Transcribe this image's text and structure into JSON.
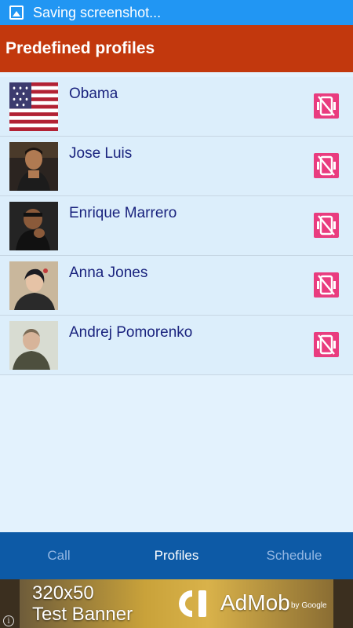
{
  "status_bar": {
    "icon": "gallery-icon",
    "text": "Saving screenshot..."
  },
  "app_bar": {
    "title": "Predefined profiles"
  },
  "profiles": [
    {
      "name": "Obama",
      "avatar": "flag-avatar",
      "action_icon": "delete-icon"
    },
    {
      "name": "Jose Luis",
      "avatar": "person-avatar",
      "action_icon": "delete-icon"
    },
    {
      "name": "Enrique Marrero",
      "avatar": "person-avatar",
      "action_icon": "delete-icon"
    },
    {
      "name": "Anna Jones",
      "avatar": "person-avatar",
      "action_icon": "delete-icon"
    },
    {
      "name": "Andrej Pomorenko",
      "avatar": "person-avatar",
      "action_icon": "delete-icon"
    }
  ],
  "tabs": [
    {
      "label": "Call",
      "active": false
    },
    {
      "label": "Profiles",
      "active": true
    },
    {
      "label": "Schedule",
      "active": false
    }
  ],
  "ad": {
    "title_line1": "320x50",
    "title_line2": "Test Banner",
    "brand": "AdMob",
    "by": "by Google"
  },
  "colors": {
    "status_bar": "#2196f3",
    "app_bar": "#c2380d",
    "list_bg": "#e3f2fd",
    "name_text": "#1a237e",
    "delete_icon": "#e93c7f",
    "tabs_bg": "#0d5aa6"
  }
}
